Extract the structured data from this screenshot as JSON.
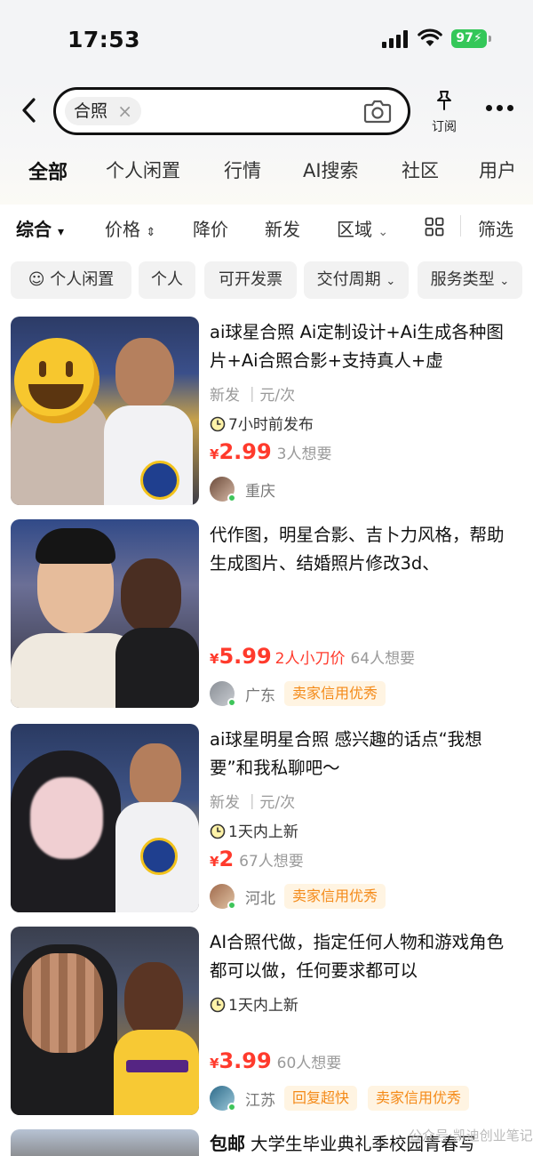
{
  "status_bar": {
    "time": "17:53",
    "battery": "97"
  },
  "search": {
    "query_chip": "合照",
    "chip_close": "×"
  },
  "header": {
    "subscribe_label": "订阅"
  },
  "category_tabs": [
    "全部",
    "个人闲置",
    "行情",
    "AI搜索",
    "社区",
    "用户"
  ],
  "sort_bar": {
    "comprehensive": "综合",
    "price": "价格",
    "price_drop": "降价",
    "newest": "新发",
    "region": "区域",
    "filter": "筛选"
  },
  "filter_chips": [
    "个人闲置",
    "个人",
    "可开发票",
    "交付周期",
    "服务类型"
  ],
  "items": [
    {
      "title": "ai球星合照 Ai定制设计+Ai生成各种图片+Ai合照合影+支持真人+虚",
      "meta": "新发 ｜元/次",
      "time_tag": "7小时前发布",
      "price_symbol": "¥",
      "price": "2.99",
      "discount": "",
      "want": "3人想要",
      "location": "重庆",
      "badges": []
    },
    {
      "title": "代作图，明星合影、吉卜力风格，帮助生成图片、结婚照片修改3d、",
      "meta": "",
      "time_tag": "",
      "price_symbol": "¥",
      "price": "5.99",
      "discount": "2人小刀价",
      "want": "64人想要",
      "location": "广东",
      "badges": [
        "卖家信用优秀"
      ]
    },
    {
      "title": "ai球星明星合照 感兴趣的话点“我想要”和我私聊吧～",
      "meta": "新发 ｜元/次",
      "time_tag": "1天内上新",
      "price_symbol": "¥",
      "price": "2",
      "discount": "",
      "want": "67人想要",
      "location": "河北",
      "badges": [
        "卖家信用优秀"
      ]
    },
    {
      "title": "AI合照代做，指定任何人物和游戏角色都可以做，任何要求都可以",
      "meta": "",
      "time_tag": "1天内上新",
      "price_symbol": "¥",
      "price": "3.99",
      "discount": "",
      "want": "60人想要",
      "location": "江苏",
      "badges": [
        "回复超快",
        "卖家信用优秀"
      ]
    },
    {
      "free_ship": "包邮",
      "title": "大学生毕业典礼季校园青春写"
    }
  ],
  "watermark": "公众号·凯迪创业笔记"
}
